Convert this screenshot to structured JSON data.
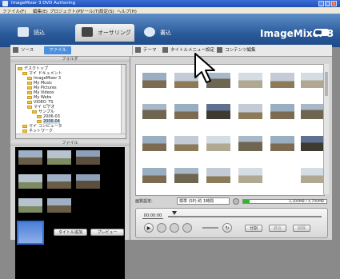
{
  "window": {
    "title": "ImageMixer 3 DVD Authoring"
  },
  "menu": [
    "ファイル(F)",
    "編集(E)",
    "プロジェクト(P)",
    "ツール(T)",
    "設定(S)",
    "ヘルプ(H)"
  ],
  "mode_tabs": [
    {
      "label": "読込",
      "icon": "camera-icon"
    },
    {
      "label": "オーサリング",
      "icon": "video-camera-icon"
    },
    {
      "label": "書込",
      "icon": "disc-icon"
    }
  ],
  "brand": "ImageMixer 3",
  "toolbar": {
    "source_label": "ソース",
    "file_label": "ファイル",
    "theme_label": "テーマ",
    "menu_edit_label": "タイトルメニュー設定",
    "contents_label": "コンテンツ編集"
  },
  "left": {
    "folder_header": "フォルダ",
    "file_header": "ファイル",
    "tree": [
      "デスクトップ",
      "マイ ドキュメント",
      "ImageMixer 3",
      "My Music",
      "My Pictures",
      "My Videos",
      "My Webs",
      "VIDEO_TS",
      "マイ ビデオ",
      "サンプル",
      "2006-03",
      "2006-04",
      "マイ コンピュータ",
      "ネットワーク"
    ],
    "add_button": "タイトル追加",
    "preview_button": "プレビュー"
  },
  "right": {
    "quality_label": "画質設定:",
    "quality_value": "標準 (SP) 約 1時間",
    "capacity": "3,300MB / 4,700MB",
    "capacity_fraction": 0.08
  },
  "player": {
    "timecode": "00:00:00",
    "play_symbol": "▶",
    "buttons": [
      "分割",
      "結合",
      "削除"
    ]
  }
}
